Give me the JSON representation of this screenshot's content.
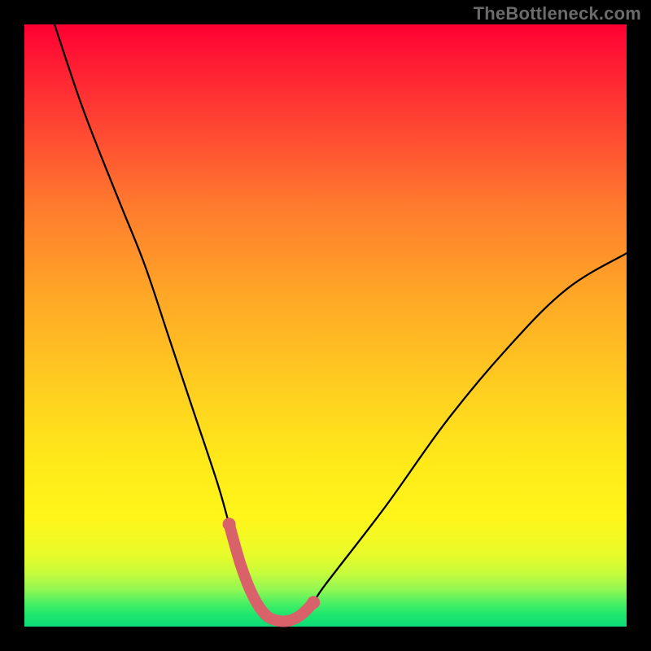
{
  "watermark": "TheBottleneck.com",
  "chart_data": {
    "type": "line",
    "title": "",
    "xlabel": "",
    "ylabel": "",
    "xlim": [
      0,
      100
    ],
    "ylim": [
      0,
      100
    ],
    "series": [
      {
        "name": "black-curve",
        "color": "#000000",
        "x": [
          5,
          9,
          12,
          16,
          20,
          24,
          28,
          32,
          34,
          36,
          38,
          40,
          42,
          44,
          46,
          48,
          50,
          60,
          70,
          80,
          90,
          100
        ],
        "y": [
          100,
          88,
          80,
          70,
          60,
          48,
          36,
          24,
          17,
          10,
          5,
          2,
          1,
          1,
          2,
          4,
          7,
          20,
          34,
          46,
          56,
          62
        ]
      },
      {
        "name": "dip-highlight",
        "color": "#d9616a",
        "x": [
          34,
          36,
          38,
          40,
          42,
          44,
          46,
          48
        ],
        "y": [
          17,
          10,
          5,
          2,
          1,
          1,
          2,
          4
        ]
      }
    ],
    "gradient_stops": [
      {
        "pos": 0,
        "color": "#ff0033"
      },
      {
        "pos": 16,
        "color": "#ff4233"
      },
      {
        "pos": 45,
        "color": "#ffa726"
      },
      {
        "pos": 72,
        "color": "#ffe81a"
      },
      {
        "pos": 91,
        "color": "#c8fb3a"
      },
      {
        "pos": 100,
        "color": "#0edc78"
      }
    ]
  }
}
